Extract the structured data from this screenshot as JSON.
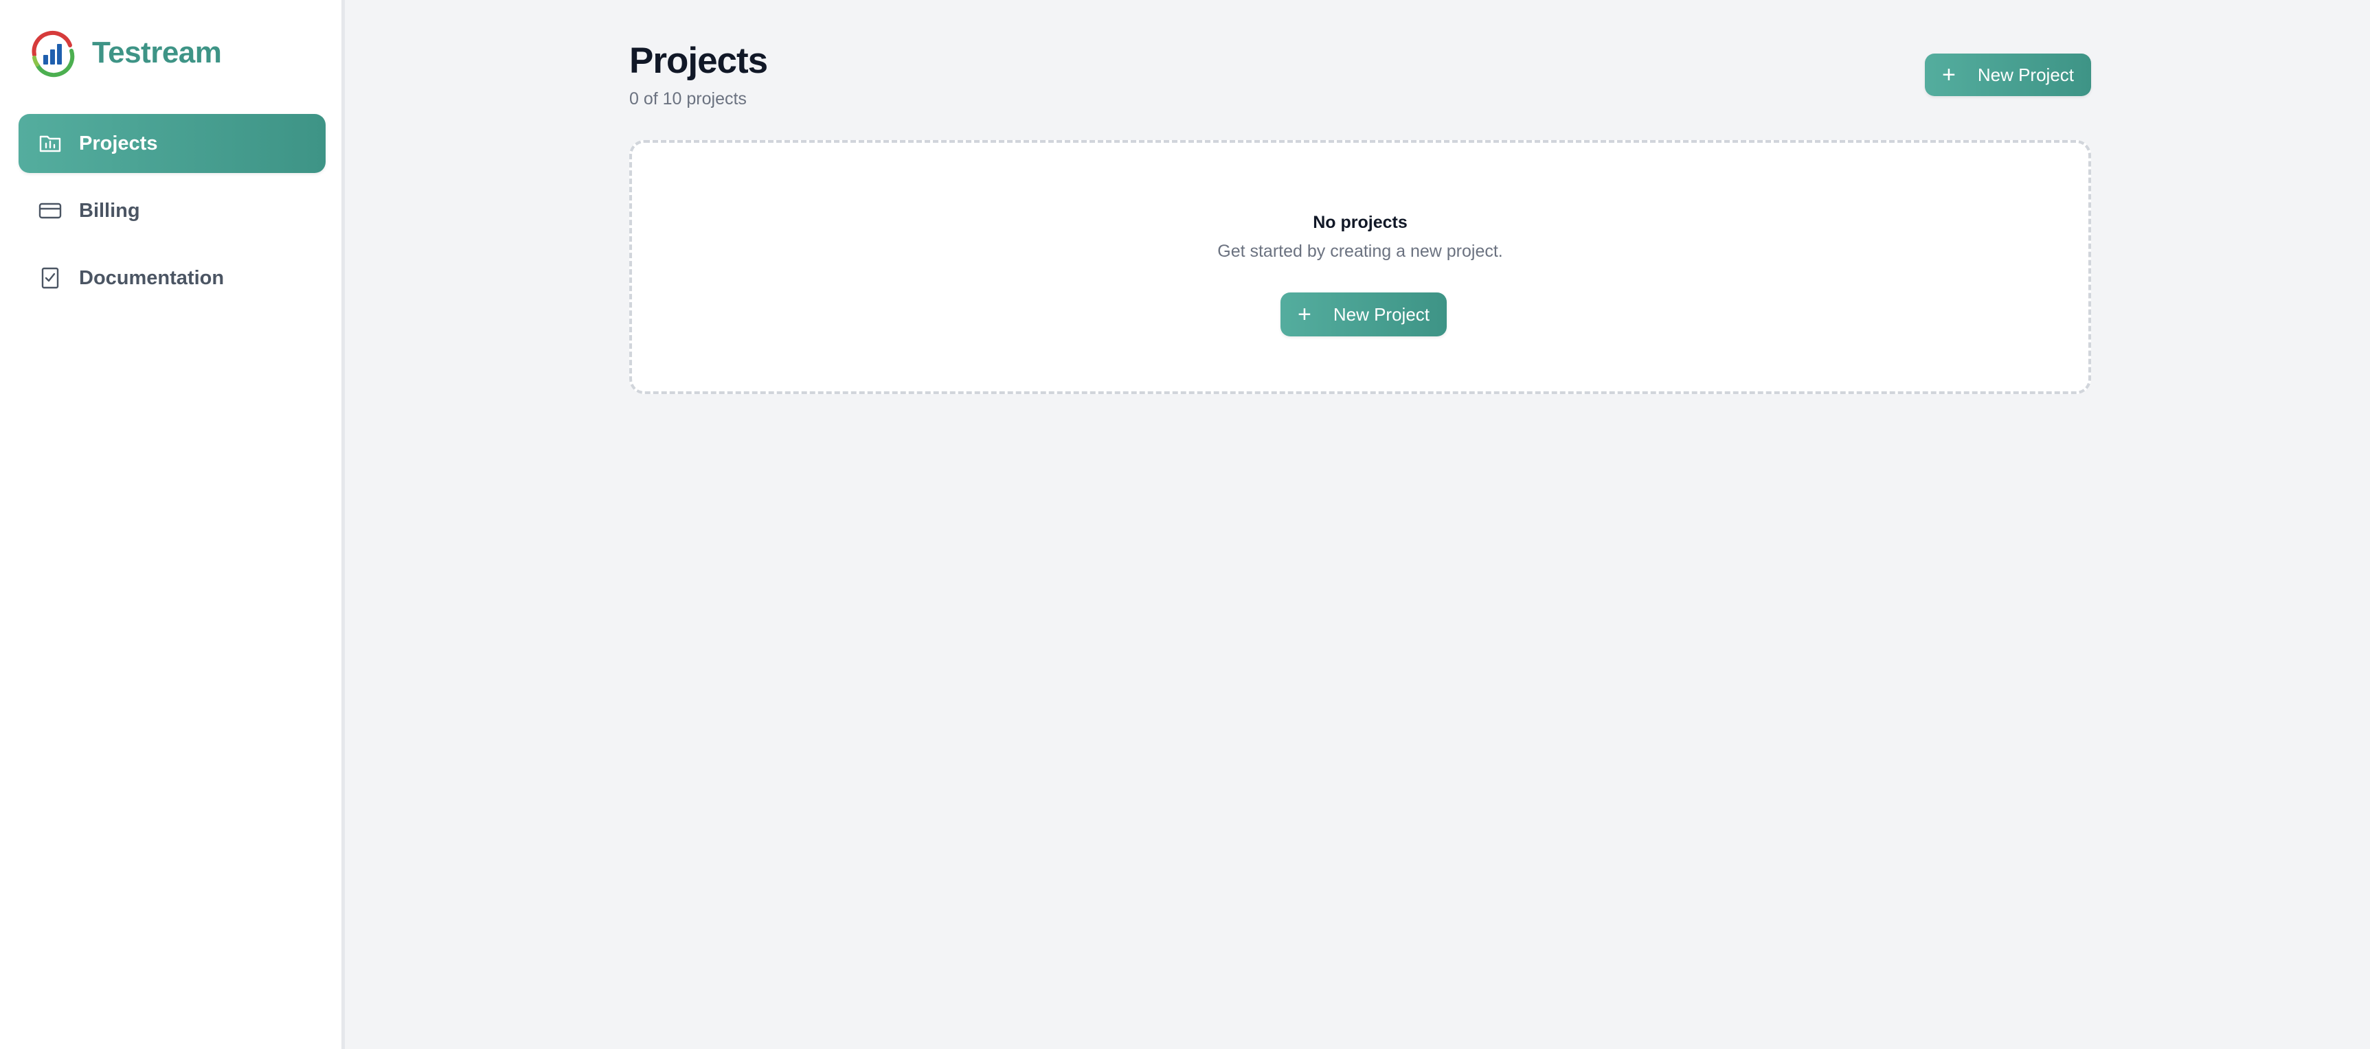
{
  "brand": {
    "name": "Testream",
    "logo_icon": "testream-logo-icon",
    "color": "#3e9486"
  },
  "sidebar": {
    "items": [
      {
        "label": "Projects",
        "icon": "folder-chart-icon",
        "active": true
      },
      {
        "label": "Billing",
        "icon": "credit-card-icon",
        "active": false
      },
      {
        "label": "Documentation",
        "icon": "checklist-doc-icon",
        "active": false
      }
    ]
  },
  "header": {
    "title": "Projects",
    "subtitle": "0 of 10 projects",
    "new_project_label": "New Project"
  },
  "empty_state": {
    "title": "No projects",
    "description": "Get started by creating a new project.",
    "button_label": "New Project"
  },
  "colors": {
    "accent": "#3e9486",
    "accent_light": "#54ad9e",
    "background": "#f3f4f6"
  }
}
